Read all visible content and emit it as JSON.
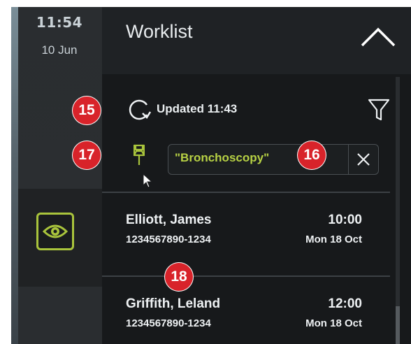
{
  "status_bar": {
    "time": "11:54",
    "date": "10 Jun"
  },
  "worklist": {
    "title": "Worklist",
    "updated_label": "Updated 11:43",
    "search_filter": "\"Bronchoscopy\"",
    "items": [
      {
        "name": "Elliott, James",
        "id": "1234567890-1234",
        "time": "10:00",
        "date": "Mon 18 Oct"
      },
      {
        "name": "Griffith, Leland",
        "id": "1234567890-1234",
        "time": "12:00",
        "date": "Mon 18 Oct"
      }
    ]
  },
  "callouts": {
    "c15": "15",
    "c16": "16",
    "c17": "17",
    "c18": "18"
  },
  "colors": {
    "accent": "#a9c43c",
    "callout": "#d8232a",
    "background": "#17191b"
  },
  "icons": [
    "refresh-icon",
    "filter-icon",
    "pin-icon",
    "close-icon",
    "eye-icon",
    "chevron-up-icon",
    "cursor-arrow-icon"
  ]
}
